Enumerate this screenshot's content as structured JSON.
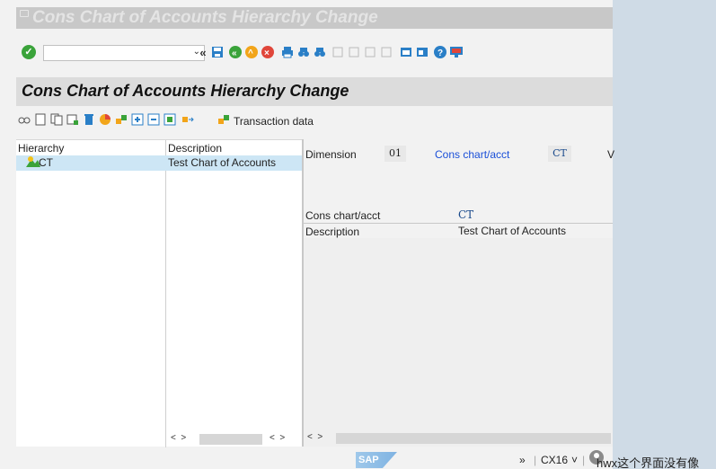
{
  "window": {
    "title": "Cons Chart of Accounts Hierarchy Change"
  },
  "toolbar": {
    "command_field_value": "",
    "icons": [
      "check-icon",
      "dropdown-icon",
      "back-double-icon",
      "save-icon",
      "back-icon",
      "exit-icon",
      "cancel-icon",
      "print-icon",
      "find-icon",
      "find-next-icon",
      "first-page-icon",
      "prev-page-icon",
      "next-page-icon",
      "last-page-icon",
      "new-session-icon",
      "shortcut-icon",
      "help-icon",
      "customize-icon"
    ]
  },
  "page": {
    "title": "Cons Chart of Accounts Hierarchy Change"
  },
  "app_toolbar": {
    "transaction_label": "Transaction data",
    "icons": [
      "glasses-icon",
      "create-icon",
      "copy-icon",
      "insert-icon",
      "delete-icon",
      "cut-icon",
      "move-icon",
      "expand-icon",
      "collapse-icon",
      "select-icon",
      "reassign-icon"
    ]
  },
  "tree": {
    "col_hierarchy": "Hierarchy",
    "col_description": "Description",
    "rows": [
      {
        "node": "CT",
        "description": "Test Chart of Accounts"
      }
    ]
  },
  "detail": {
    "dimension_label": "Dimension",
    "dimension_value": "01",
    "cons_chart_link": "Cons chart/acct",
    "cons_chart_value": "CT",
    "truncated_label": "V",
    "fields": [
      {
        "label": "Cons chart/acct",
        "value": "CT"
      },
      {
        "label": "Description",
        "value": "Test Chart of Accounts"
      }
    ]
  },
  "statusbar": {
    "sap_logo": "SAP",
    "expand": "»",
    "system": "CX16",
    "dropdown": "˅",
    "user_text": "hwx这个界面没有像"
  },
  "colors": {
    "accent_link": "#1a4fd8",
    "selection": "#cde6f5",
    "ok_green": "#3aa33a"
  }
}
